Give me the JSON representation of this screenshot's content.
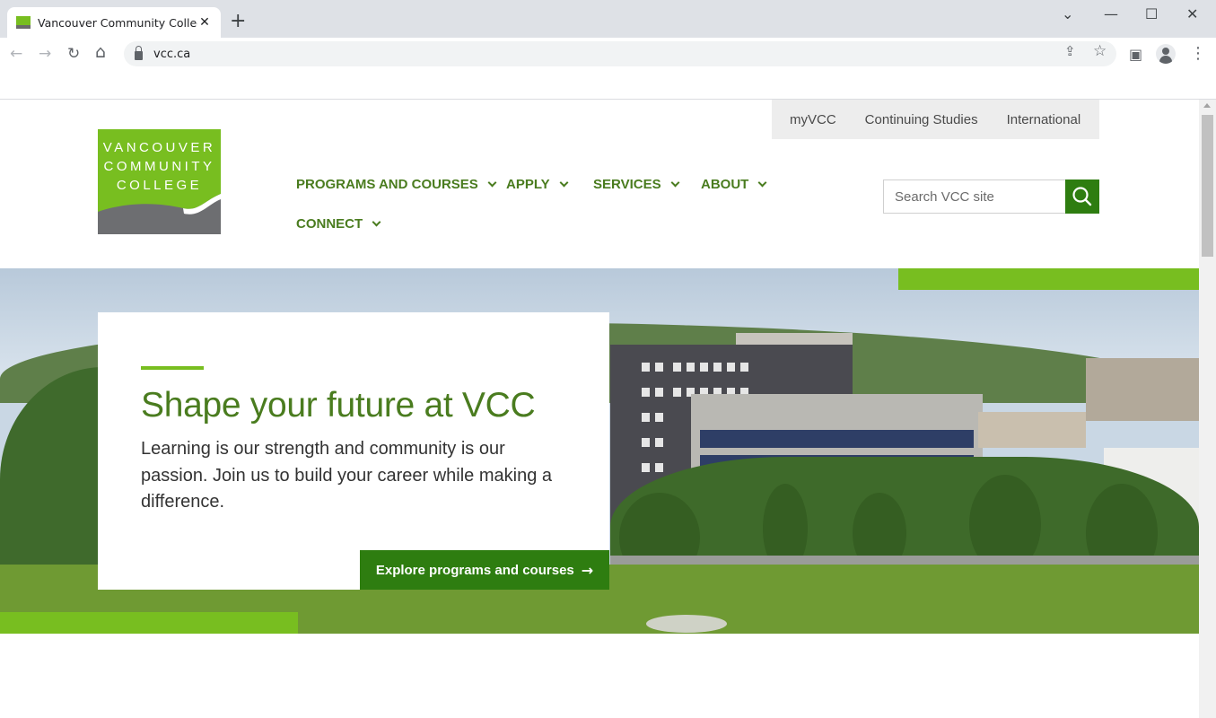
{
  "browser": {
    "tab": {
      "title": "Vancouver Community College -",
      "close_glyph": "✕"
    },
    "new_tab_glyph": "+",
    "window_controls": {
      "tabsearch": "⌄",
      "minimize": "—",
      "maximize": "☐",
      "close": "✕"
    },
    "nav": {
      "back": "←",
      "forward": "→",
      "reload": "↻",
      "home": "⌂"
    },
    "url": "vcc.ca",
    "icons": [
      "share-icon",
      "star-icon",
      "side-panel-icon",
      "profile-icon",
      "menu-icon"
    ],
    "icon_glyphs": {
      "share": "⇪",
      "star": "☆",
      "side_panel": "▣",
      "menu": "⋮"
    }
  },
  "site": {
    "utility_links": [
      "myVCC",
      "Continuing Studies",
      "International"
    ],
    "logo": {
      "line1": "VANCOUVER",
      "line2": "COMMUNITY",
      "line3": "COLLEGE"
    },
    "nav": [
      "PROGRAMS AND COURSES",
      "APPLY",
      "SERVICES",
      "ABOUT",
      "CONNECT"
    ],
    "search": {
      "placeholder": "Search VCC site"
    },
    "hero": {
      "heading": "Shape your future at VCC",
      "body": "Learning is our strength and community is our passion. Join us to build your career while making a difference.",
      "cta": "Explore programs and courses",
      "cta_arrow": "→"
    },
    "colors": {
      "brand_green": "#78be20",
      "dark_green": "#2e7d10",
      "text_green": "#4a7c1f"
    }
  }
}
